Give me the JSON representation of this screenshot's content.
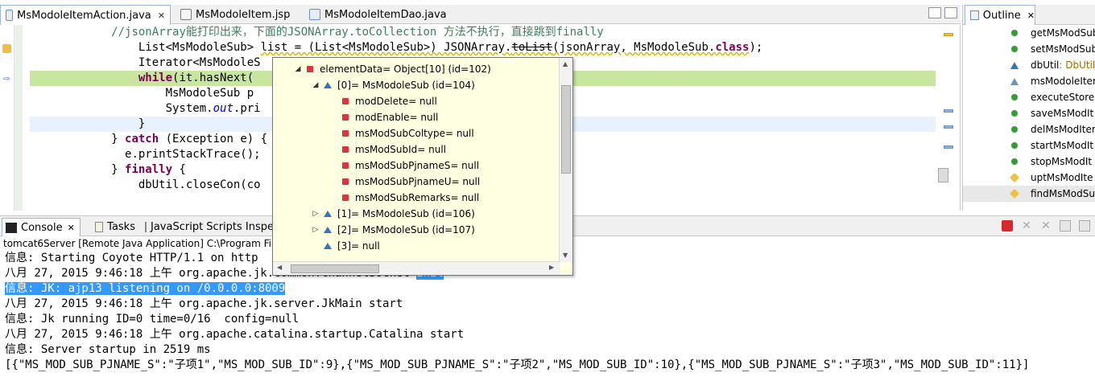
{
  "editor": {
    "tabs": [
      {
        "label": "MsModoleItemAction.java",
        "close": "✕"
      },
      {
        "label": "MsModoleItem.jsp"
      },
      {
        "label": "MsModoleItemDao.java"
      }
    ],
    "code": {
      "line1_comment": "//jsonArray能打印出来，下面的JSONArray.toCollection 方法不执行，直接跳到finally",
      "line2_a": "List<MsModoleSub> ",
      "line2_b": "list = (List<MsModoleSub>) JSONArray.",
      "line2_c": "toList",
      "line2_d": "(jsonArray, MsModoleSub.",
      "line2_e": "class",
      "line2_f": ");",
      "line3": "Iterator<MsModoleS",
      "line4_kw": "while",
      "line4_rest": "(it.hasNext(",
      "line5": "MsModoleSub p",
      "line6_a": "System.",
      "line6_b": "out",
      "line6_c": ".pri",
      "line7": "}",
      "line8_a": "} ",
      "line8_kw": "catch",
      "line8_b": " (Exception e) {",
      "line9": "e.printStackTrace();",
      "line10_a": "} ",
      "line10_kw": "finally",
      "line10_b": " {",
      "line11": "dbUtil.closeCon(co"
    }
  },
  "outline": {
    "tab_label": "Outline",
    "close": "✕",
    "items": [
      {
        "label": "getMsModSub"
      },
      {
        "label": "setMsModSub"
      },
      {
        "label": "dbUtil",
        "type": " : DbUtil"
      },
      {
        "label": "msModoleIter"
      },
      {
        "label": "executeStore()"
      },
      {
        "label": "saveMsModIt"
      },
      {
        "label": "delMsModIter"
      },
      {
        "label": "startMsModIt"
      },
      {
        "label": "stopMsModIt"
      },
      {
        "label": "uptMsModIte"
      },
      {
        "label": "findMsModSu"
      }
    ]
  },
  "popup": {
    "rows": [
      {
        "label": "elementData= Object[10]  (id=102)"
      },
      {
        "label": "[0]= MsModoleSub  (id=104)"
      },
      {
        "label": "modDelete= null"
      },
      {
        "label": "modEnable= null"
      },
      {
        "label": "msModSubColtype= null"
      },
      {
        "label": "msModSubId= null"
      },
      {
        "label": "msModSubPjnameS= null"
      },
      {
        "label": "msModSubPjnameU= null"
      },
      {
        "label": "msModSubRemarks= null"
      },
      {
        "label": "[1]= MsModoleSub  (id=106)"
      },
      {
        "label": "[2]= MsModoleSub  (id=107)"
      },
      {
        "label": "[3]= null"
      }
    ]
  },
  "console": {
    "tabs": [
      {
        "label": "Console",
        "close": "✕"
      },
      {
        "label": "Tasks"
      },
      {
        "label": "JavaScript Scripts Inspe"
      }
    ],
    "process": "tomcat6Server [Remote Java Application] C:\\Program File",
    "lines": [
      {
        "text": "信息: Starting Coyote HTTP/1.1 on http"
      },
      {
        "text": "八月 27, 2015 9:46:18 上午 org.apache.jk.common.ChannelSocket ",
        "sel": "init"
      },
      {
        "text": "",
        "sel": "信息: JK: ajp13 listening on /0.0.0.0:8009"
      },
      {
        "text": "八月 27, 2015 9:46:18 上午 org.apache.jk.server.JkMain start"
      },
      {
        "text": "信息: Jk running ID=0 time=0/16  config=null"
      },
      {
        "text": "八月 27, 2015 9:46:18 上午 org.apache.catalina.startup.Catalina start"
      },
      {
        "text": "信息: Server startup in 2519 ms"
      },
      {
        "text": "[{\"MS_MOD_SUB_PJNAME_S\":\"子项1\",\"MS_MOD_SUB_ID\":9},{\"MS_MOD_SUB_PJNAME_S\":\"子项2\",\"MS_MOD_SUB_ID\":10},{\"MS_MOD_SUB_PJNAME_S\":\"子项3\",\"MS_MOD_SUB_ID\":11}]"
      }
    ]
  }
}
